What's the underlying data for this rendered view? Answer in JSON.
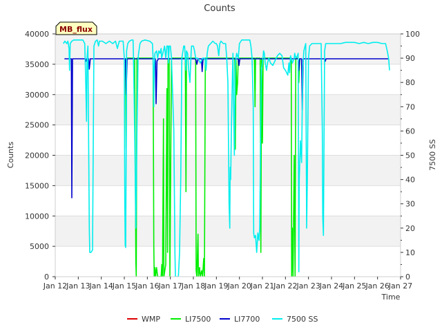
{
  "chart_data": {
    "type": "line",
    "title": "Counts",
    "xlabel": "Time",
    "ylabel": "Counts",
    "y2label": "7500 SS",
    "badge": "MB_flux",
    "xlim": [
      12,
      27
    ],
    "ylim": [
      0,
      40000
    ],
    "y2lim": [
      0,
      100
    ],
    "x_ticks": [
      12,
      13,
      14,
      15,
      16,
      17,
      18,
      19,
      20,
      21,
      22,
      23,
      24,
      25,
      26,
      27
    ],
    "x_tick_labels": [
      "Jan 12",
      "Jan 13",
      "Jan 14",
      "Jan 15",
      "Jan 16",
      "Jan 17",
      "Jan 18",
      "Jan 19",
      "Jan 20",
      "Jan 21",
      "Jan 22",
      "Jan 23",
      "Jan 24",
      "Jan 25",
      "Jan 26",
      "Jan 27"
    ],
    "y_ticks": [
      0,
      5000,
      10000,
      15000,
      20000,
      25000,
      30000,
      35000,
      40000
    ],
    "y2_ticks": [
      0,
      10,
      20,
      30,
      40,
      50,
      60,
      70,
      80,
      90,
      100
    ],
    "grid": "horizontal bands",
    "legend_position": "bottom",
    "series": [
      {
        "name": "WMP",
        "color": "#dd0000",
        "axis": "left",
        "points": []
      },
      {
        "name": "LI7500",
        "color": "#00ee00",
        "axis": "left",
        "points": [
          [
            15.05,
            36000
          ],
          [
            15.08,
            21000
          ],
          [
            15.1,
            36000
          ],
          [
            15.45,
            36000
          ],
          [
            15.5,
            2500
          ],
          [
            15.52,
            0
          ],
          [
            15.55,
            36000
          ],
          [
            16.25,
            36000
          ],
          [
            16.28,
            5000
          ],
          [
            16.3,
            0
          ],
          [
            16.33,
            1500
          ],
          [
            16.36,
            0
          ],
          [
            16.4,
            1500
          ],
          [
            16.45,
            0
          ],
          [
            16.6,
            0
          ],
          [
            16.63,
            2000
          ],
          [
            16.66,
            0
          ],
          [
            16.7,
            26000
          ],
          [
            16.72,
            0
          ],
          [
            16.8,
            2000
          ],
          [
            16.85,
            31000
          ],
          [
            16.88,
            4000
          ],
          [
            16.9,
            36000
          ],
          [
            16.95,
            36000
          ],
          [
            16.98,
            0
          ],
          [
            17.05,
            36000
          ],
          [
            17.65,
            36000
          ],
          [
            17.68,
            14000
          ],
          [
            17.7,
            36000
          ],
          [
            18.1,
            36000
          ],
          [
            18.12,
            1000
          ],
          [
            18.15,
            0
          ],
          [
            18.2,
            7000
          ],
          [
            18.22,
            0
          ],
          [
            18.27,
            1500
          ],
          [
            18.3,
            0
          ],
          [
            18.36,
            1000
          ],
          [
            18.4,
            0
          ],
          [
            18.45,
            3000
          ],
          [
            18.48,
            0
          ],
          [
            18.52,
            36000
          ],
          [
            19.8,
            36000
          ],
          [
            19.82,
            21000
          ],
          [
            19.85,
            36000
          ],
          [
            19.88,
            30000
          ],
          [
            19.92,
            32000
          ],
          [
            19.95,
            36000
          ],
          [
            20.65,
            36000
          ],
          [
            20.68,
            28000
          ],
          [
            20.7,
            36000
          ],
          [
            20.9,
            36000
          ],
          [
            20.93,
            4000
          ],
          [
            20.96,
            36000
          ],
          [
            21.0,
            22000
          ],
          [
            21.03,
            36000
          ],
          [
            22.25,
            36000
          ],
          [
            22.27,
            0
          ],
          [
            22.3,
            8000
          ],
          [
            22.33,
            0
          ],
          [
            22.38,
            20000
          ],
          [
            22.42,
            0
          ],
          [
            22.45,
            36000
          ],
          [
            22.55,
            36000
          ],
          [
            22.58,
            32000
          ],
          [
            22.62,
            36000
          ]
        ]
      },
      {
        "name": "LI7700",
        "color": "#0000cc",
        "axis": "left",
        "points": [
          [
            12.4,
            35900
          ],
          [
            12.7,
            35900
          ],
          [
            12.72,
            13000
          ],
          [
            12.75,
            35900
          ],
          [
            13.3,
            35900
          ],
          [
            13.33,
            35500
          ],
          [
            13.36,
            35900
          ],
          [
            13.45,
            35900
          ],
          [
            13.48,
            34200
          ],
          [
            13.52,
            35900
          ],
          [
            15.05,
            35900
          ],
          [
            15.08,
            30000
          ],
          [
            15.12,
            35800
          ],
          [
            15.15,
            35900
          ],
          [
            16.3,
            35900
          ],
          [
            16.35,
            35900
          ],
          [
            16.38,
            28500
          ],
          [
            16.42,
            35500
          ],
          [
            16.48,
            35900
          ],
          [
            18.1,
            35900
          ],
          [
            18.15,
            35000
          ],
          [
            18.2,
            35900
          ],
          [
            18.35,
            35900
          ],
          [
            18.38,
            33800
          ],
          [
            18.42,
            35900
          ],
          [
            19.95,
            35900
          ],
          [
            19.98,
            34800
          ],
          [
            20.02,
            35900
          ],
          [
            22.55,
            35900
          ],
          [
            22.58,
            34000
          ],
          [
            22.62,
            35900
          ],
          [
            22.7,
            35900
          ],
          [
            22.73,
            27500
          ],
          [
            22.77,
            35900
          ],
          [
            23.7,
            35900
          ],
          [
            23.73,
            35500
          ],
          [
            23.76,
            35900
          ],
          [
            26.5,
            35900
          ]
        ]
      },
      {
        "name": "7500 SS",
        "color": "#00eeee",
        "axis": "right",
        "points": [
          [
            12.35,
            96
          ],
          [
            12.42,
            97
          ],
          [
            12.5,
            96
          ],
          [
            12.55,
            97
          ],
          [
            12.6,
            94
          ],
          [
            12.62,
            85
          ],
          [
            12.65,
            96
          ],
          [
            12.72,
            97
          ],
          [
            12.8,
            97.5
          ],
          [
            13.0,
            97.5
          ],
          [
            13.2,
            97.5
          ],
          [
            13.28,
            96
          ],
          [
            13.32,
            82
          ],
          [
            13.36,
            64
          ],
          [
            13.38,
            90
          ],
          [
            13.42,
            95
          ],
          [
            13.48,
            20
          ],
          [
            13.5,
            10
          ],
          [
            13.55,
            10
          ],
          [
            13.62,
            11
          ],
          [
            13.68,
            95
          ],
          [
            13.75,
            97
          ],
          [
            13.82,
            97.5
          ],
          [
            13.88,
            95
          ],
          [
            13.92,
            97
          ],
          [
            14.05,
            97
          ],
          [
            14.2,
            96
          ],
          [
            14.35,
            97
          ],
          [
            14.5,
            96
          ],
          [
            14.62,
            97
          ],
          [
            14.7,
            94
          ],
          [
            14.78,
            97
          ],
          [
            14.95,
            97
          ],
          [
            15.0,
            90
          ],
          [
            15.02,
            30
          ],
          [
            15.04,
            13
          ],
          [
            15.06,
            12
          ],
          [
            15.08,
            50
          ],
          [
            15.1,
            93
          ],
          [
            15.15,
            96
          ],
          [
            15.22,
            97
          ],
          [
            15.32,
            97.5
          ],
          [
            15.38,
            97.5
          ],
          [
            15.4,
            90
          ],
          [
            15.45,
            60
          ],
          [
            15.5,
            20
          ],
          [
            15.55,
            60
          ],
          [
            15.6,
            90
          ],
          [
            15.62,
            92
          ],
          [
            15.68,
            96
          ],
          [
            15.75,
            97
          ],
          [
            15.9,
            97.5
          ],
          [
            16.1,
            97
          ],
          [
            16.22,
            96
          ],
          [
            16.25,
            90
          ],
          [
            16.28,
            70
          ],
          [
            16.3,
            85
          ],
          [
            16.33,
            92
          ],
          [
            16.4,
            93
          ],
          [
            16.45,
            90
          ],
          [
            16.5,
            93
          ],
          [
            16.55,
            92
          ],
          [
            16.6,
            94
          ],
          [
            16.62,
            90
          ],
          [
            16.7,
            93
          ],
          [
            16.75,
            95
          ],
          [
            16.8,
            90
          ],
          [
            16.85,
            95
          ],
          [
            16.9,
            95
          ],
          [
            16.92,
            88
          ],
          [
            16.95,
            95
          ],
          [
            17.0,
            95
          ],
          [
            17.05,
            90
          ],
          [
            17.1,
            75
          ],
          [
            17.15,
            60
          ],
          [
            17.2,
            10
          ],
          [
            17.22,
            0
          ],
          [
            17.3,
            0
          ],
          [
            17.35,
            0
          ],
          [
            17.4,
            10
          ],
          [
            17.45,
            40
          ],
          [
            17.5,
            90
          ],
          [
            17.58,
            95
          ],
          [
            17.62,
            95
          ],
          [
            17.68,
            85
          ],
          [
            17.7,
            93
          ],
          [
            17.75,
            92
          ],
          [
            17.8,
            85
          ],
          [
            17.85,
            80
          ],
          [
            17.9,
            92
          ],
          [
            17.92,
            95
          ],
          [
            18.0,
            95
          ],
          [
            18.05,
            93
          ],
          [
            18.1,
            90
          ],
          [
            18.2,
            90
          ],
          [
            18.3,
            88
          ],
          [
            18.4,
            90
          ],
          [
            18.5,
            90
          ],
          [
            18.55,
            85
          ],
          [
            18.6,
            92
          ],
          [
            18.65,
            95
          ],
          [
            18.75,
            96
          ],
          [
            18.85,
            97
          ],
          [
            18.95,
            96
          ],
          [
            19.0,
            96
          ],
          [
            19.05,
            95
          ],
          [
            19.1,
            91
          ],
          [
            19.15,
            96
          ],
          [
            19.2,
            97
          ],
          [
            19.3,
            96
          ],
          [
            19.4,
            96
          ],
          [
            19.45,
            90
          ],
          [
            19.5,
            80
          ],
          [
            19.55,
            30
          ],
          [
            19.58,
            20
          ],
          [
            19.6,
            45
          ],
          [
            19.62,
            40
          ],
          [
            19.65,
            60
          ],
          [
            19.7,
            85
          ],
          [
            19.72,
            92
          ],
          [
            19.78,
            50
          ],
          [
            19.82,
            88
          ],
          [
            19.88,
            92
          ],
          [
            19.95,
            90
          ],
          [
            20.0,
            96
          ],
          [
            20.1,
            97.5
          ],
          [
            20.25,
            97.5
          ],
          [
            20.35,
            97.5
          ],
          [
            20.45,
            97.5
          ],
          [
            20.5,
            95
          ],
          [
            20.55,
            90
          ],
          [
            20.6,
            70
          ],
          [
            20.62,
            18
          ],
          [
            20.65,
            16
          ],
          [
            20.7,
            17
          ],
          [
            20.75,
            10
          ],
          [
            20.8,
            18
          ],
          [
            20.85,
            15
          ],
          [
            20.88,
            20
          ],
          [
            20.92,
            55
          ],
          [
            20.95,
            85
          ],
          [
            21.0,
            88
          ],
          [
            21.05,
            93
          ],
          [
            21.08,
            92
          ],
          [
            21.12,
            88
          ],
          [
            21.18,
            85
          ],
          [
            21.22,
            88
          ],
          [
            21.28,
            90
          ],
          [
            21.35,
            88
          ],
          [
            21.45,
            87
          ],
          [
            21.55,
            89
          ],
          [
            21.65,
            91
          ],
          [
            21.75,
            92
          ],
          [
            21.85,
            91
          ],
          [
            21.92,
            86
          ],
          [
            22.0,
            85
          ],
          [
            22.05,
            84
          ],
          [
            22.1,
            83
          ],
          [
            22.15,
            88
          ],
          [
            22.18,
            84
          ],
          [
            22.22,
            91
          ],
          [
            22.3,
            88
          ],
          [
            22.38,
            90
          ],
          [
            22.4,
            92
          ],
          [
            22.45,
            90
          ],
          [
            22.52,
            91
          ],
          [
            22.55,
            92
          ],
          [
            22.58,
            2
          ],
          [
            22.6,
            40
          ],
          [
            22.65,
            56
          ],
          [
            22.7,
            47
          ],
          [
            22.75,
            86
          ],
          [
            22.8,
            93
          ],
          [
            22.85,
            95
          ],
          [
            22.88,
            96
          ],
          [
            22.92,
            20
          ],
          [
            22.95,
            40
          ],
          [
            23.0,
            90
          ],
          [
            23.05,
            95
          ],
          [
            23.15,
            96
          ],
          [
            23.3,
            96
          ],
          [
            23.4,
            96
          ],
          [
            23.55,
            96
          ],
          [
            23.6,
            60
          ],
          [
            23.62,
            25
          ],
          [
            23.65,
            17
          ],
          [
            23.68,
            62
          ],
          [
            23.7,
            93
          ],
          [
            23.75,
            96
          ],
          [
            23.85,
            96
          ],
          [
            24.0,
            96
          ],
          [
            24.2,
            96
          ],
          [
            24.4,
            96
          ],
          [
            24.6,
            96.5
          ],
          [
            24.8,
            96.5
          ],
          [
            25.0,
            96.5
          ],
          [
            25.2,
            96
          ],
          [
            25.4,
            96.5
          ],
          [
            25.6,
            96
          ],
          [
            25.8,
            96.5
          ],
          [
            26.0,
            96.5
          ],
          [
            26.2,
            96
          ],
          [
            26.35,
            96
          ],
          [
            26.42,
            93
          ],
          [
            26.48,
            90
          ],
          [
            26.52,
            85
          ]
        ]
      }
    ]
  }
}
